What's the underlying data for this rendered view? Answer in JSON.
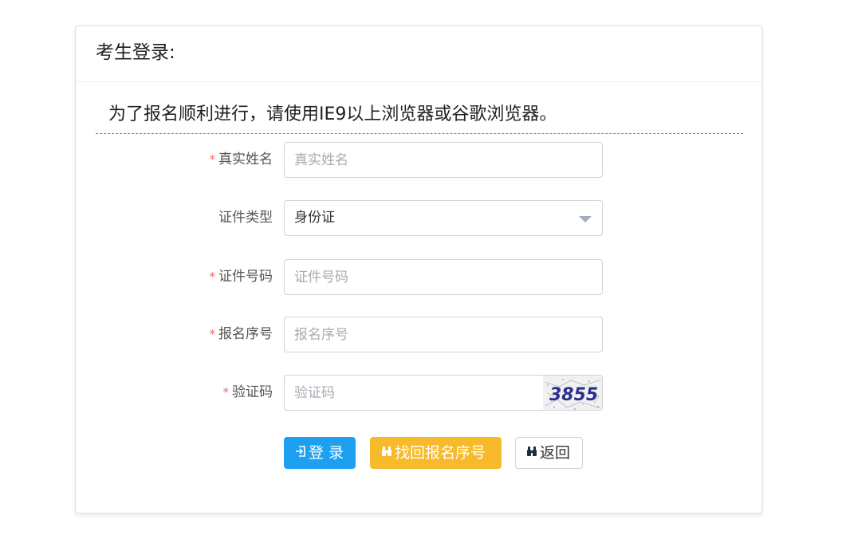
{
  "header": {
    "title": "考生登录:"
  },
  "notice": "为了报名顺利进行，请使用IE9以上浏览器或谷歌浏览器。",
  "form": {
    "required_mark": "*",
    "real_name": {
      "label": "真实姓名",
      "placeholder": "真实姓名",
      "required": true
    },
    "id_type": {
      "label": "证件类型",
      "value": "身份证",
      "required": false
    },
    "id_number": {
      "label": "证件号码",
      "placeholder": "证件号码",
      "required": true
    },
    "reg_number": {
      "label": "报名序号",
      "placeholder": "报名序号",
      "required": true
    },
    "captcha": {
      "label": "验证码",
      "placeholder": "验证码",
      "image_text": "3855",
      "required": true
    }
  },
  "buttons": {
    "login": {
      "label": "登 录",
      "icon": "sign-in-icon"
    },
    "find": {
      "label": "找回报名序号",
      "icon": "binoculars-icon"
    },
    "back": {
      "label": "返回",
      "icon": "binoculars-icon"
    }
  },
  "colors": {
    "primary": "#1ea0f0",
    "warning": "#f7ba2a",
    "required": "#f56c6c",
    "notice_underline": "#3a8ee6"
  }
}
